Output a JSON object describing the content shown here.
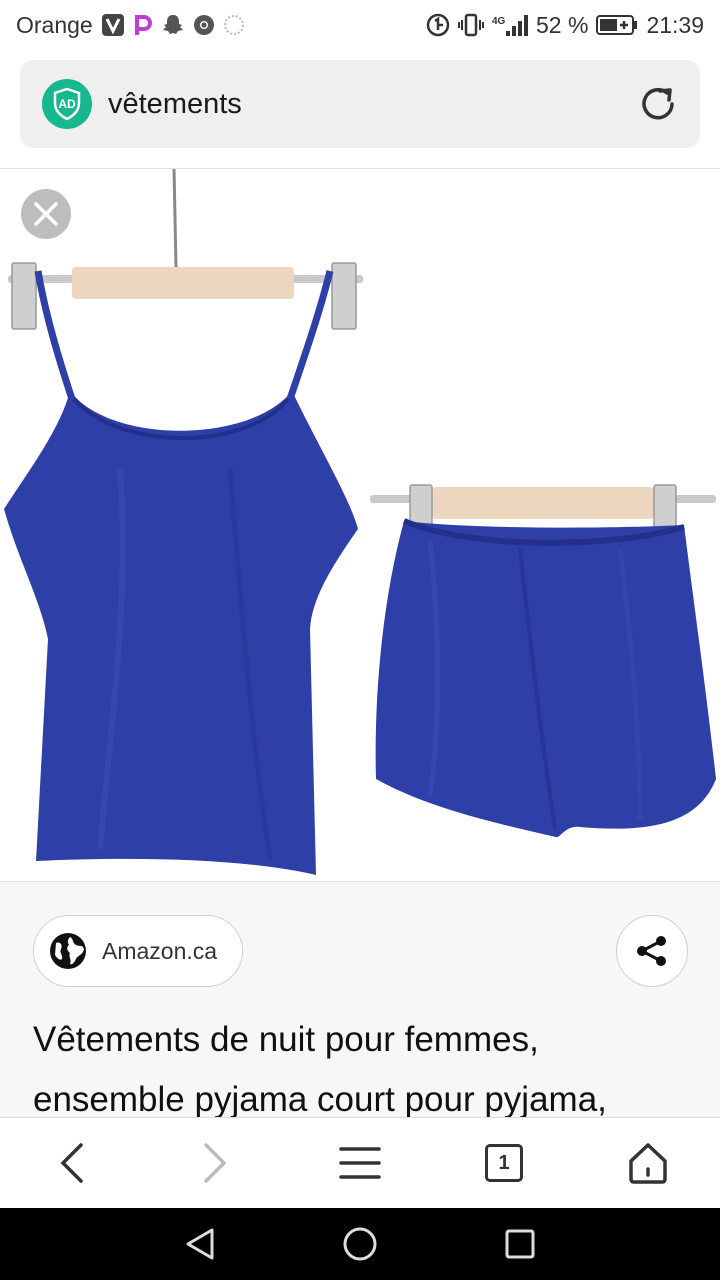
{
  "status_bar": {
    "carrier": "Orange",
    "network": "4G",
    "battery": "52 %",
    "time": "21:39",
    "icons": [
      "v-app-icon",
      "picsart-icon",
      "snapchat-icon",
      "chrome-icon",
      "settings-dots-icon",
      "data-saver-icon",
      "vibrate-icon",
      "signal-icon",
      "battery-icon"
    ]
  },
  "address_bar": {
    "query": "vêtements",
    "badge_label": "AD",
    "badge_color": "#17b890"
  },
  "image_viewer": {
    "close_icon": "close-icon",
    "garment_color": "#2e3fa7"
  },
  "info_panel": {
    "source_label": "Amazon.ca",
    "source_icon": "globe-icon",
    "share_icon": "share-icon",
    "description": "Vêtements de nuit pour femmes, ensemble pyjama court pour pyjama,"
  },
  "browser_toolbar": {
    "tab_count": "1",
    "icons": [
      "back-icon",
      "forward-icon",
      "menu-icon",
      "tabs-icon",
      "home-icon"
    ]
  },
  "nav_bar": {
    "icons": [
      "nav-back-icon",
      "nav-home-icon",
      "nav-recents-icon"
    ]
  }
}
